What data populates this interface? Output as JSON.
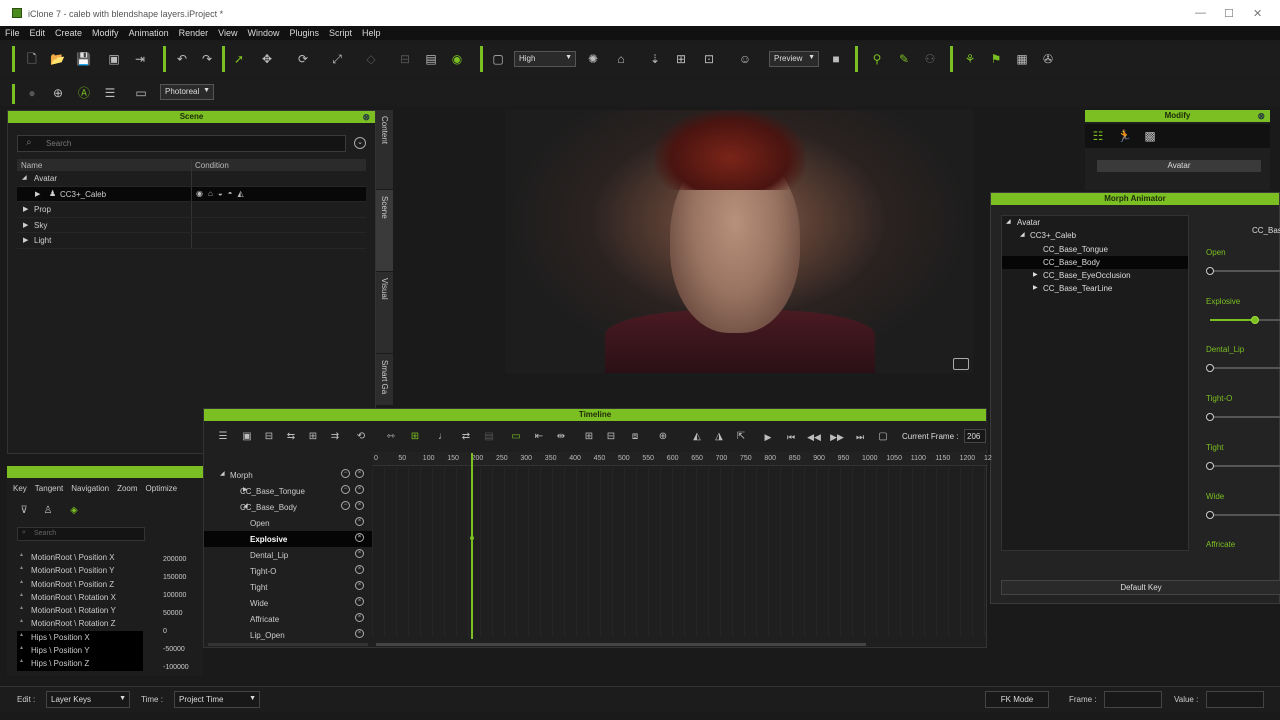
{
  "window": {
    "title": "iClone 7 - caleb with blendshape layers.iProject *"
  },
  "menu": [
    "File",
    "Edit",
    "Create",
    "Modify",
    "Animation",
    "Render",
    "View",
    "Window",
    "Plugins",
    "Script",
    "Help"
  ],
  "toolbar": {
    "quality": "High",
    "preview": "Preview",
    "render_mode": "Photoreal"
  },
  "scene_panel": {
    "title": "Scene",
    "search_placeholder": "Search",
    "columns": [
      "Name",
      "Condition"
    ],
    "rows": [
      {
        "label": "Avatar",
        "indent": 0,
        "expanded": true
      },
      {
        "label": "CC3+_Caleb",
        "indent": 1,
        "selected": true
      },
      {
        "label": "Prop",
        "indent": 0
      },
      {
        "label": "Sky",
        "indent": 0
      },
      {
        "label": "Light",
        "indent": 0
      }
    ]
  },
  "side_tabs": [
    "Content",
    "Scene",
    "Visual",
    "Smart Ga"
  ],
  "modify_panel": {
    "title": "Modify",
    "section": "Avatar"
  },
  "morph_animator": {
    "title": "Morph Animator",
    "header_label": "CC_Bas",
    "tree": [
      {
        "label": "Avatar",
        "level": 0
      },
      {
        "label": "CC3+_Caleb",
        "level": 1
      },
      {
        "label": "CC_Base_Tongue",
        "level": 2
      },
      {
        "label": "CC_Base_Body",
        "level": 2,
        "selected": true
      },
      {
        "label": "CC_Base_EyeOcclusion",
        "level": 2
      },
      {
        "label": "CC_Base_TearLine",
        "level": 2
      }
    ],
    "sliders": [
      {
        "label": "Open",
        "value": 0.0
      },
      {
        "label": "Explosive",
        "value": 0.62
      },
      {
        "label": "Dental_Lip",
        "value": 0.0
      },
      {
        "label": "Tight-O",
        "value": 0.0
      },
      {
        "label": "Tight",
        "value": 0.0
      },
      {
        "label": "Wide",
        "value": 0.0
      },
      {
        "label": "Affricate",
        "value": null
      }
    ],
    "default_key": "Default Key"
  },
  "timeline": {
    "title": "Timeline",
    "current_frame_label": "Current Frame :",
    "current_frame": "206",
    "ruler": [
      "0",
      "50",
      "100",
      "150",
      "200",
      "250",
      "300",
      "350",
      "400",
      "450",
      "500",
      "550",
      "600",
      "650",
      "700",
      "750",
      "800",
      "850",
      "900",
      "950",
      "1000",
      "1050",
      "1100",
      "1150",
      "1200",
      "12"
    ],
    "tracks": [
      {
        "label": "Morph",
        "level": 0
      },
      {
        "label": "CC_Base_Tongue",
        "level": 1
      },
      {
        "label": "CC_Base_Body",
        "level": 1
      },
      {
        "label": "Open",
        "level": 2
      },
      {
        "label": "Explosive",
        "level": 2,
        "selected": true
      },
      {
        "label": "Dental_Lip",
        "level": 2
      },
      {
        "label": "Tight-O",
        "level": 2
      },
      {
        "label": "Tight",
        "level": 2
      },
      {
        "label": "Wide",
        "level": 2
      },
      {
        "label": "Affricate",
        "level": 2
      },
      {
        "label": "Lip_Open",
        "level": 2
      }
    ]
  },
  "curve_editor": {
    "tabs": [
      "Key",
      "Tangent",
      "Navigation",
      "Zoom",
      "Optimize"
    ],
    "search_placeholder": "Search",
    "channels": [
      "MotionRoot \\ Position X",
      "MotionRoot \\ Position Y",
      "MotionRoot \\ Position Z",
      "MotionRoot \\ Rotation X",
      "MotionRoot \\ Rotation Y",
      "MotionRoot \\ Rotation Z",
      "Hips \\ Position X",
      "Hips \\ Position Y",
      "Hips \\ Position Z"
    ],
    "values": [
      "200000",
      "150000",
      "100000",
      "50000",
      "0",
      "-50000",
      "-100000"
    ]
  },
  "status": {
    "edit_label": "Edit :",
    "edit_value": "Layer Keys",
    "time_label": "Time :",
    "time_value": "Project Time",
    "fk_mode": "FK Mode",
    "frame_label": "Frame :",
    "value_label": "Value :"
  }
}
